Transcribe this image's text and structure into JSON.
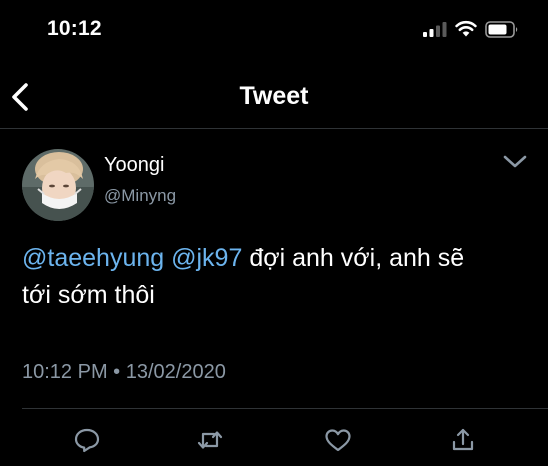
{
  "status_bar": {
    "time": "10:12",
    "icons": [
      "cellular-signal-icon",
      "wifi-icon",
      "battery-icon"
    ]
  },
  "nav": {
    "back_icon": "chevron-left-icon",
    "title": "Tweet"
  },
  "tweet": {
    "author_name": "Yoongi",
    "author_handle": "@Minyng",
    "menu_icon": "chevron-down-icon",
    "mention_1": "@taeehyung",
    "mention_2": "@jk97",
    "text_line_1": "đợi anh với, anh sẽ",
    "text_line_2": "tới sớm thôi",
    "timestamp": "10:12 PM • 13/02/2020"
  },
  "actions": [
    "reply-icon",
    "retweet-icon",
    "like-icon",
    "share-icon"
  ],
  "colors": {
    "background": "#000000",
    "text": "#ffffff",
    "secondary_text": "#8b98a5",
    "mention": "#6cb4ee",
    "divider": "#2f3336"
  }
}
